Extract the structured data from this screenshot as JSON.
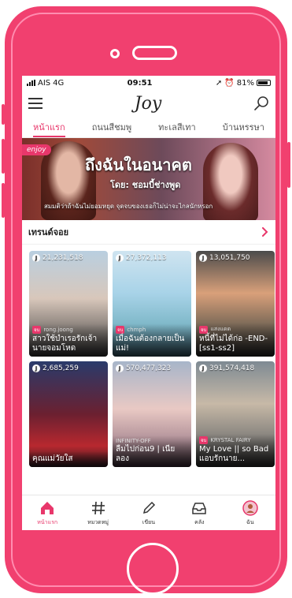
{
  "status": {
    "carrier": "AIS",
    "network": "4G",
    "time": "09:51",
    "battery": "81%"
  },
  "app": {
    "logo": "Joy"
  },
  "tabs": [
    {
      "label": "หน้าแรก",
      "active": true
    },
    {
      "label": "ถนนสีชมพู",
      "active": false
    },
    {
      "label": "ทะเลสีเทา",
      "active": false
    },
    {
      "label": "บ้านหรรษา",
      "active": false
    }
  ],
  "banner": {
    "badge": "enjoy",
    "title": "ถึงฉันในอนาคต",
    "author": "โดย: ชอมบี้ช่างพูด",
    "subtitle": "สมมติว่าถ้าฉันไม่ยอมหยุด จุดจบของเธอก็ไม่น่าจะไกลนักหรอก"
  },
  "trend": {
    "title": "เทรนด์จอย"
  },
  "cards": [
    {
      "views": "21,231,518",
      "tag": "จบ",
      "author": "rong.joong",
      "title": "สาวใช้บำเรอรักเจ้านายจอมโหด",
      "bg": "linear-gradient(180deg,#b9cfe0 0%,#d8c7bb 45%,#3a3a3a 100%)"
    },
    {
      "views": "27,372,113",
      "tag": "จบ",
      "author": "chmph",
      "title": "เมื่อฉันต้องกลายเป็นแม่!",
      "bg": "linear-gradient(180deg,#cfe4f0 0%,#a8d3e8 40%,#7fb8c9 70%,#3a6070 100%)"
    },
    {
      "views": "13,051,750",
      "tag": "จบ",
      "author": "แสงแดด",
      "title": "หนี้ที่ไม่ได้ก่อ -END- [ss1-ss2]",
      "bg": "linear-gradient(180deg,#4b4b4b 0%,#d9a07a 40%,#7c6a58 70%,#2a2a2a 100%)"
    },
    {
      "views": "2,685,259",
      "tag": "",
      "author": "",
      "title": "คุณแม่วัยใส",
      "bg": "linear-gradient(180deg,#2a3b6b 0%,#6b2030 50%,#b8282f 80%,#301a20 100%)"
    },
    {
      "views": "570,477,323",
      "tag": "",
      "author": "INFINITY-OFF",
      "title": "ลืมไปก่อน9 | เนียลอง",
      "bg": "linear-gradient(180deg,#a7b5c9 0%,#e9c9c4 45%,#b09098 75%,#40303a 100%)"
    },
    {
      "views": "391,574,418",
      "tag": "จบ",
      "author": "KRYSTAL FAIRY",
      "title": "My Love || so Bad แอบรักนาย...",
      "bg": "linear-gradient(180deg,#7e8a93 0%,#c7b9a7 40%,#8a8680 70%,#2f2f2f 100%)"
    }
  ],
  "nav": [
    {
      "label": "หน้าแรก",
      "icon": "home-icon",
      "active": true
    },
    {
      "label": "หมวดหมู่",
      "icon": "hashtag-icon",
      "active": false
    },
    {
      "label": "เขียน",
      "icon": "pencil-icon",
      "active": false
    },
    {
      "label": "คลัง",
      "icon": "inbox-icon",
      "active": false
    },
    {
      "label": "ฉัน",
      "icon": "avatar-icon",
      "active": false
    }
  ],
  "colors": {
    "accent": "#e8376b",
    "phone": "#f1406f"
  }
}
